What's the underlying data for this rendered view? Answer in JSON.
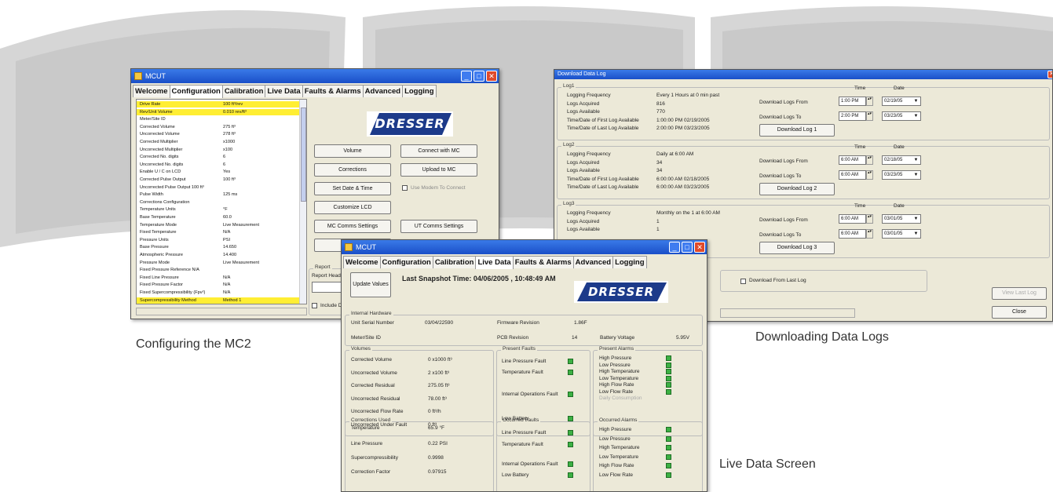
{
  "captions": {
    "configuring": "Configuring the MC2",
    "downloading": "Downloading Data Logs",
    "live": "Live Data Screen"
  },
  "config_window": {
    "title": "MCUT",
    "tabs": [
      "Welcome",
      "Configuration",
      "Calibration",
      "Live Data",
      "Faults & Alarms",
      "Advanced",
      "Logging"
    ],
    "active_tab": "Configuration",
    "rows": [
      {
        "k": "Drive Rate",
        "v": "100 ft³/rev",
        "hl": true
      },
      {
        "k": "Rev/Unit Volume",
        "v": "0.010 rev/ft³",
        "hl": true
      },
      {
        "k": "Meter/Site ID",
        "v": "",
        "hl": false
      },
      {
        "k": "Corrected Volume",
        "v": "275 ft³",
        "hl": false
      },
      {
        "k": "Uncorrected Volume",
        "v": "278 ft³",
        "hl": false
      },
      {
        "k": "Corrected Multiplier",
        "v": "x1000",
        "hl": false
      },
      {
        "k": "Uncorrected Multiplier",
        "v": "x100",
        "hl": false
      },
      {
        "k": "Corrected No. digits",
        "v": "6",
        "hl": false
      },
      {
        "k": "Uncorrected No. digits",
        "v": "6",
        "hl": false
      },
      {
        "k": "Enable U / C on LCD",
        "v": "Yes",
        "hl": false
      },
      {
        "k": "Corrected Pulse Output",
        "v": "100 ft³",
        "hl": false
      },
      {
        "k": "Uncorrected Pulse Output  100 ft³",
        "v": "",
        "hl": false
      },
      {
        "k": "Pulse Width",
        "v": "125 ms",
        "hl": false
      },
      {
        "k": "Corrections Configuration",
        "v": "",
        "hl": false
      },
      {
        "k": "Temperature Units",
        "v": "°F",
        "hl": false
      },
      {
        "k": "Base Temperature",
        "v": "60.0",
        "hl": false
      },
      {
        "k": "Temperature Mode",
        "v": "Live Measurement",
        "hl": false
      },
      {
        "k": "Fixed Temperature",
        "v": "N/A",
        "hl": false
      },
      {
        "k": "Pressure Units",
        "v": "PSI",
        "hl": false
      },
      {
        "k": "Base Pressure",
        "v": "14.650",
        "hl": false
      },
      {
        "k": "Atmospheric Pressure",
        "v": "14.400",
        "hl": false
      },
      {
        "k": "Pressure Mode",
        "v": "Live Measurement",
        "hl": false
      },
      {
        "k": "Fixed Pressure Reference  N/A",
        "v": "",
        "hl": false
      },
      {
        "k": "Fixed Line Pressure",
        "v": "N/A",
        "hl": false
      },
      {
        "k": "Fixed Pressure Factor",
        "v": "N/A",
        "hl": false
      },
      {
        "k": "Fixed Supercompressibility (Fpv²)",
        "v": "N/A",
        "hl": false
      },
      {
        "k": "Supercompressibility Method",
        "v": "Method 1",
        "hl": true
      }
    ],
    "logo": "DRESSER",
    "buttons": {
      "volume": "Volume",
      "connect": "Connect with MC",
      "corrections": "Corrections",
      "upload": "Upload to MC",
      "set_date": "Set Date & Time",
      "customize": "Customize LCD",
      "mc_comms": "MC Comms Settings",
      "ut_comms": "UT Comms Settings",
      "open": "Open"
    },
    "use_modem": "Use Modem To Connect",
    "report": {
      "title": "Report",
      "header": "Report Head",
      "include": "Include D"
    }
  },
  "download_window": {
    "title": "Download Data Log",
    "logs": [
      {
        "title": "Log1",
        "freq_label": "Logging Frequency",
        "freq": "Every 1 Hours at 0 min past",
        "acq_label": "Logs Acquired",
        "acq": "816",
        "avail_label": "Logs Available",
        "avail": "770",
        "first_label": "Time/Date of First Log Available",
        "first": "1:00:00 PM 02/19/2005",
        "last_label": "Time/Date of Last Log Available",
        "last": "2:00:00 PM 03/23/2005",
        "from_time": "1:00 PM",
        "from_date": "02/19/05",
        "to_time": "2:00 PM",
        "to_date": "03/23/05",
        "button": "Download Log 1"
      },
      {
        "title": "Log2",
        "freq_label": "Logging Frequency",
        "freq": "Daily at 6:00 AM",
        "acq_label": "Logs Acquired",
        "acq": "34",
        "avail_label": "Logs Available",
        "avail": "34",
        "first_label": "Time/Date of First Log Available",
        "first": "6:00:00 AM 02/18/2005",
        "last_label": "Time/Date of Last Log Available",
        "last": "6:00:00 AM 03/23/2005",
        "from_time": "6:00 AM",
        "from_date": "02/18/05",
        "to_time": "6:00 AM",
        "to_date": "03/23/05",
        "button": "Download Log 2"
      },
      {
        "title": "Log3",
        "freq_label": "Logging Frequency",
        "freq": "Monthly on the 1 at 6:00 AM",
        "acq_label": "Logs Acquired",
        "acq": "1",
        "avail_label": "Logs Available",
        "avail": "1",
        "first_label": "",
        "first": "",
        "last_label": "",
        "last": "",
        "from_time": "6:00 AM",
        "from_date": "03/01/05",
        "to_time": "6:00 AM",
        "to_date": "03/01/05",
        "button": "Download Log 3"
      }
    ],
    "col_time": "Time",
    "col_date": "Date",
    "from_label": "Download Logs From",
    "to_label": "Download Logs To",
    "from_last": "Download From Last Log",
    "view_last": "View Last Log",
    "close": "Close"
  },
  "live_window": {
    "title": "MCUT",
    "tabs": [
      "Welcome",
      "Configuration",
      "Calibration",
      "Live Data",
      "Faults & Alarms",
      "Advanced",
      "Logging"
    ],
    "active_tab": "Live Data",
    "update_button": "Update Values",
    "snapshot": "Last Snapshot Time: 04/06/2005 , 10:48:49 AM",
    "logo": "DRESSER",
    "hardware": {
      "title": "Internal Hardware",
      "serial_label": "Unit Serial Number",
      "serial": "03/04/22590",
      "fw_label": "Firmware Revision",
      "fw": "1.86F",
      "site_label": "Meter/Site ID",
      "pcb_label": "PCB Revision",
      "pcb": "14",
      "batt_label": "Battery Voltage",
      "batt": "5.95V"
    },
    "volumes": {
      "title": "Volumes",
      "rows": [
        {
          "k": "Corrected Volume",
          "v": "0 x1000 ft³"
        },
        {
          "k": "Uncorrected Volume",
          "v": "2 x100 ft³"
        },
        {
          "k": "Corrected Residual",
          "v": "275.05 ft³"
        },
        {
          "k": "Uncorrected Residual",
          "v": "78.00 ft³"
        },
        {
          "k": "Uncorrected Flow Rate",
          "v": "0 ft³/h"
        },
        {
          "k": "Uncorrected Under Fault",
          "v": "0 ft³"
        }
      ]
    },
    "present_faults": {
      "title": "Present Faults",
      "items": [
        "Line Pressure Fault",
        "Temperature Fault",
        "Internal Operations Fault",
        "Low Battery"
      ]
    },
    "present_alarms": {
      "title": "Present Alarms",
      "items": [
        "High Pressure",
        "Low Pressure",
        "High Temperature",
        "Low Temperature",
        "High Flow Rate",
        "Low Flow Rate"
      ],
      "disabled": "Daily Consumption"
    },
    "corrections": {
      "title": "Corrections Used",
      "rows": [
        {
          "k": "Temperature",
          "v": "65.9 °F"
        },
        {
          "k": "Line Pressure",
          "v": "0.22 PSI"
        },
        {
          "k": "Supercompressibility",
          "v": "0.9998"
        },
        {
          "k": "Correction Factor",
          "v": "0.97915"
        }
      ]
    },
    "occurred_faults": {
      "title": "Occurred Faults",
      "items": [
        "Line Pressure Fault",
        "Temperature Fault",
        "Internal Operations Fault",
        "Low Battery"
      ]
    },
    "occurred_alarms": {
      "title": "Occurred Alarms",
      "items": [
        "High Pressure",
        "Low Pressure",
        "High Temperature",
        "Low Temperature",
        "High Flow Rate",
        "Low Flow Rate"
      ]
    }
  }
}
